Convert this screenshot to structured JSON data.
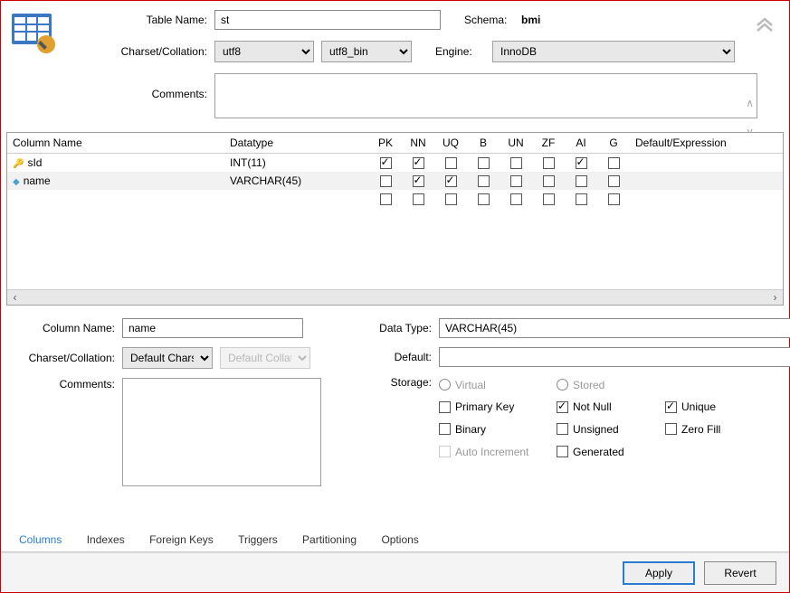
{
  "header": {
    "table_name_label": "Table Name:",
    "table_name_value": "st",
    "schema_label": "Schema:",
    "schema_value": "bmi",
    "charset_label": "Charset/Collation:",
    "charset_value": "utf8",
    "collation_value": "utf8_bin",
    "engine_label": "Engine:",
    "engine_value": "InnoDB",
    "comments_label": "Comments:",
    "comments_value": ""
  },
  "grid": {
    "headers": {
      "column_name": "Column Name",
      "datatype": "Datatype",
      "pk": "PK",
      "nn": "NN",
      "uq": "UQ",
      "b": "B",
      "un": "UN",
      "zf": "ZF",
      "ai": "AI",
      "g": "G",
      "default": "Default/Expression"
    },
    "rows": [
      {
        "icon": "key",
        "name": "sId",
        "datatype": "INT(11)",
        "pk": true,
        "nn": true,
        "uq": false,
        "b": false,
        "un": false,
        "zf": false,
        "ai": true,
        "g": false,
        "default": ""
      },
      {
        "icon": "diamond",
        "name": "name",
        "datatype": "VARCHAR(45)",
        "pk": false,
        "nn": true,
        "uq": true,
        "b": false,
        "un": false,
        "zf": false,
        "ai": false,
        "g": false,
        "default": ""
      },
      {
        "icon": "",
        "name": "",
        "datatype": "",
        "pk": false,
        "nn": false,
        "uq": false,
        "b": false,
        "un": false,
        "zf": false,
        "ai": false,
        "g": false,
        "default": ""
      }
    ]
  },
  "detail": {
    "column_name_label": "Column Name:",
    "column_name_value": "name",
    "charset_label": "Charset/Collation:",
    "charset_value": "Default Charset",
    "collation_value": "Default Collation",
    "comments_label": "Comments:",
    "comments_value": "",
    "datatype_label": "Data Type:",
    "datatype_value": "VARCHAR(45)",
    "default_label": "Default:",
    "default_value": "",
    "storage_label": "Storage:",
    "virtual": "Virtual",
    "stored": "Stored",
    "primary_key": "Primary Key",
    "not_null": "Not Null",
    "unique": "Unique",
    "binary": "Binary",
    "unsigned": "Unsigned",
    "zero_fill": "Zero Fill",
    "auto_increment": "Auto Increment",
    "generated": "Generated",
    "flags": {
      "primary_key": false,
      "not_null": true,
      "unique": true,
      "binary": false,
      "unsigned": false,
      "zero_fill": false,
      "auto_increment": false,
      "generated": false
    }
  },
  "tabs": {
    "columns": "Columns",
    "indexes": "Indexes",
    "foreign_keys": "Foreign Keys",
    "triggers": "Triggers",
    "partitioning": "Partitioning",
    "options": "Options"
  },
  "footer": {
    "apply": "Apply",
    "revert": "Revert"
  }
}
